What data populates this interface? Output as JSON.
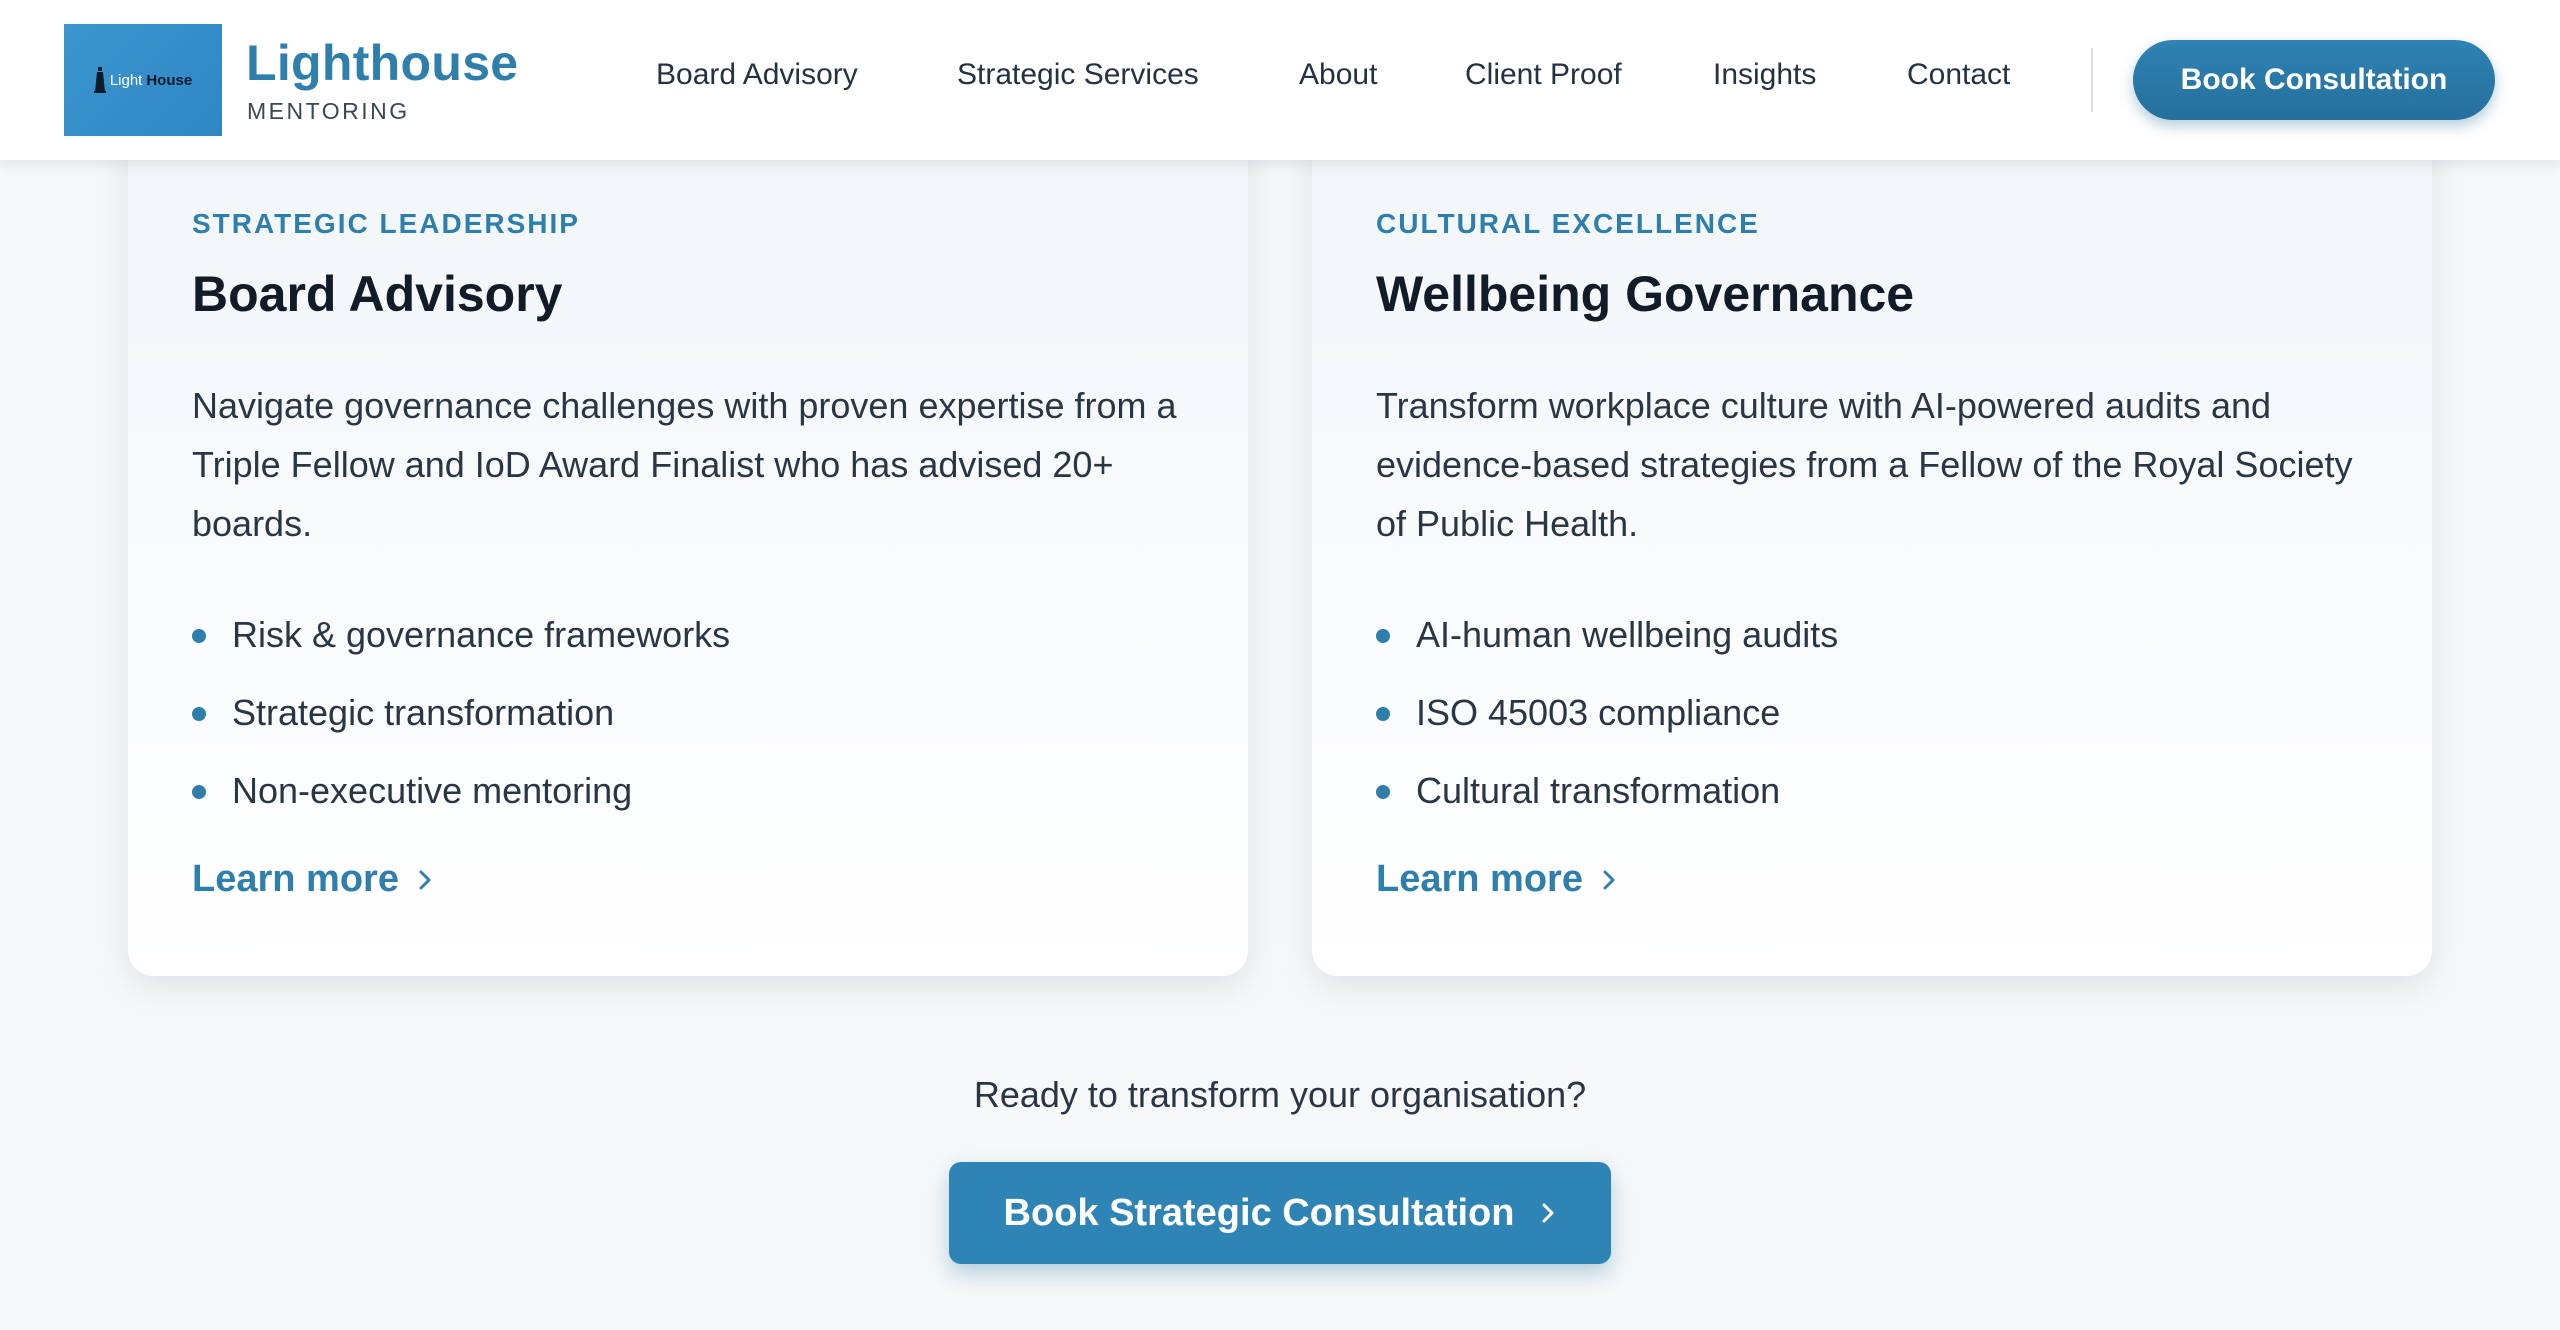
{
  "header": {
    "logo_text_light": "Light",
    "logo_text_bold": "House",
    "brand_title": "Lighthouse",
    "brand_subtitle": "MENTORING",
    "nav": [
      {
        "label": "Board Advisory"
      },
      {
        "label": "Strategic Services"
      },
      {
        "label": "About"
      },
      {
        "label": "Client Proof"
      },
      {
        "label": "Insights"
      },
      {
        "label": "Contact"
      }
    ],
    "cta_label": "Book Consultation"
  },
  "cards": [
    {
      "eyebrow": "STRATEGIC LEADERSHIP",
      "title": "Board Advisory",
      "description": "Navigate governance challenges with proven expertise from a Triple Fellow and IoD Award Finalist who has advised 20+ boards.",
      "features": [
        "Risk & governance frameworks",
        "Strategic transformation",
        "Non-executive mentoring"
      ],
      "link_label": "Learn more"
    },
    {
      "eyebrow": "CULTURAL EXCELLENCE",
      "title": "Wellbeing Governance",
      "description": "Transform workplace culture with AI-powered audits and evidence-based strategies from a Fellow of the Royal Society of Public Health.",
      "features": [
        "AI-human wellbeing audits",
        "ISO 45003 compliance",
        "Cultural transformation"
      ],
      "link_label": "Learn more"
    }
  ],
  "cta": {
    "prompt": "Ready to transform your organisation?",
    "button_label": "Book Strategic Consultation"
  },
  "colors": {
    "accent": "#2e7fac",
    "button": "#2f84b6",
    "logo_bg": "#3b96cf",
    "page_bg": "#f6f8f9"
  },
  "icons": {
    "logo": "lighthouse-icon",
    "link_arrow": "chevron-right-icon"
  }
}
